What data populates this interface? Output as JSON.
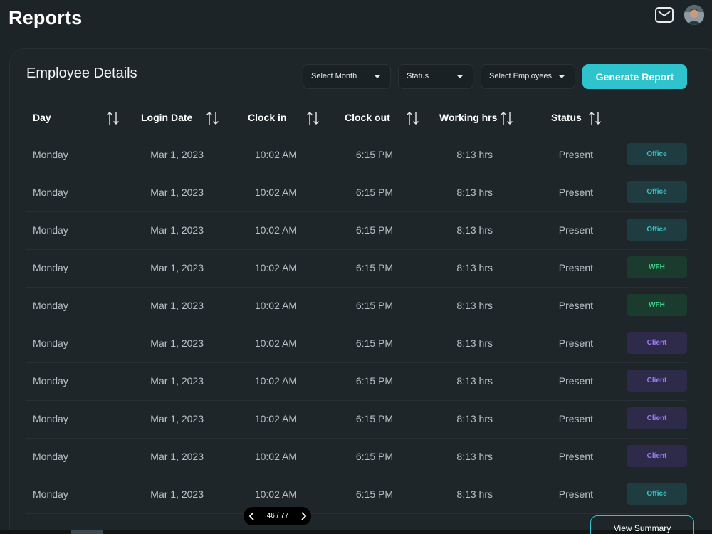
{
  "header": {
    "title": "Reports"
  },
  "panel": {
    "title": "Employee Details",
    "filters": {
      "month": "Select Month",
      "status": "Status",
      "employees": "Select Employees"
    },
    "generate_label": "Generate Report"
  },
  "table": {
    "columns": [
      "Day",
      "Login Date",
      "Clock in",
      "Clock out",
      "Working hrs",
      "Status"
    ],
    "rows": [
      {
        "day": "Monday",
        "date": "Mar 1, 2023",
        "clock_in": "10:02 AM",
        "clock_out": "6:15 PM",
        "hours": "8:13 hrs",
        "status": "Present",
        "location": "Office"
      },
      {
        "day": "Monday",
        "date": "Mar 1, 2023",
        "clock_in": "10:02 AM",
        "clock_out": "6:15 PM",
        "hours": "8:13 hrs",
        "status": "Present",
        "location": "Office"
      },
      {
        "day": "Monday",
        "date": "Mar 1, 2023",
        "clock_in": "10:02 AM",
        "clock_out": "6:15 PM",
        "hours": "8:13 hrs",
        "status": "Present",
        "location": "Office"
      },
      {
        "day": "Monday",
        "date": "Mar 1, 2023",
        "clock_in": "10:02 AM",
        "clock_out": "6:15 PM",
        "hours": "8:13 hrs",
        "status": "Present",
        "location": "WFH"
      },
      {
        "day": "Monday",
        "date": "Mar 1, 2023",
        "clock_in": "10:02 AM",
        "clock_out": "6:15 PM",
        "hours": "8:13 hrs",
        "status": "Present",
        "location": "WFH"
      },
      {
        "day": "Monday",
        "date": "Mar 1, 2023",
        "clock_in": "10:02 AM",
        "clock_out": "6:15 PM",
        "hours": "8:13 hrs",
        "status": "Present",
        "location": "Client"
      },
      {
        "day": "Monday",
        "date": "Mar 1, 2023",
        "clock_in": "10:02 AM",
        "clock_out": "6:15 PM",
        "hours": "8:13 hrs",
        "status": "Present",
        "location": "Client"
      },
      {
        "day": "Monday",
        "date": "Mar 1, 2023",
        "clock_in": "10:02 AM",
        "clock_out": "6:15 PM",
        "hours": "8:13 hrs",
        "status": "Present",
        "location": "Client"
      },
      {
        "day": "Monday",
        "date": "Mar 1, 2023",
        "clock_in": "10:02 AM",
        "clock_out": "6:15 PM",
        "hours": "8:13 hrs",
        "status": "Present",
        "location": "Client"
      },
      {
        "day": "Monday",
        "date": "Mar 1, 2023",
        "clock_in": "10:02 AM",
        "clock_out": "6:15 PM",
        "hours": "8:13 hrs",
        "status": "Present",
        "location": "Office"
      }
    ]
  },
  "badge_styles": {
    "Office": {
      "bg": "#1f3d40",
      "fg": "#38c2c9"
    },
    "WFH": {
      "bg": "#1b3b2e",
      "fg": "#3fd38a"
    },
    "Client": {
      "bg": "#2e2a4a",
      "fg": "#9a7cf2"
    }
  },
  "pagination": {
    "label": "46 / 77"
  },
  "footer": {
    "summary_label": "View Summary"
  },
  "icons": [
    "mail-icon",
    "avatar",
    "sort-icon",
    "chevron-left-icon",
    "chevron-right-icon",
    "caret-down-icon"
  ],
  "colors": {
    "accent": "#2fc4cd",
    "background": "#1d2427"
  }
}
